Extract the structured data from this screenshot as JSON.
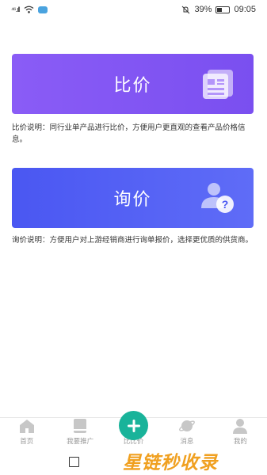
{
  "status_bar": {
    "signal": "⁴⁶.ıll",
    "battery_percent": "39%",
    "time": "09:05"
  },
  "cards": {
    "compare": {
      "title": "比价",
      "description": "比价说明：同行业单产品进行比价，方便用户更直观的查看产品价格信息。",
      "icon": "document-list-icon"
    },
    "inquiry": {
      "title": "询价",
      "description": "询价说明：方便用户对上游经销商进行询单报价，选择更优质的供货商。",
      "icon": "user-question-icon"
    }
  },
  "bottom_nav": {
    "items": [
      {
        "label": "首页",
        "icon": "home-icon"
      },
      {
        "label": "我要推广",
        "icon": "book-icon"
      },
      {
        "label": "比比价",
        "icon": "plus-icon"
      },
      {
        "label": "消息",
        "icon": "planet-icon"
      },
      {
        "label": "我的",
        "icon": "person-icon"
      }
    ]
  },
  "watermark": {
    "text": "星链秒收录"
  },
  "colors": {
    "compare_card": "#8a5cf6",
    "inquiry_card": "#4a57f2",
    "accent_green": "#19b39a",
    "watermark": "#f0a020"
  }
}
